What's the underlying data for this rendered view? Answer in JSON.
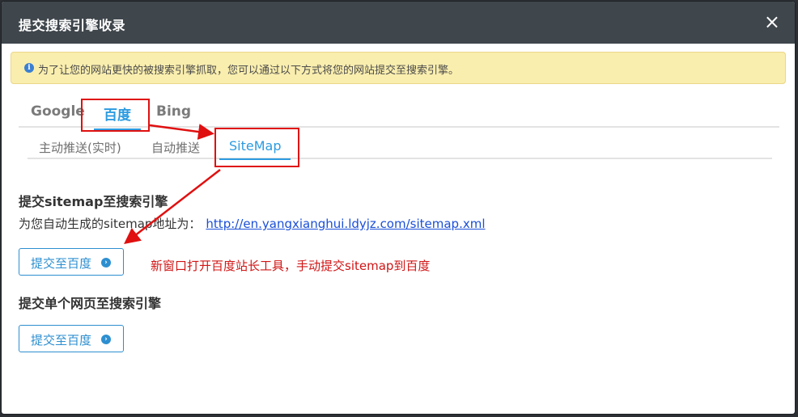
{
  "dialog": {
    "title": "提交搜索引擎收录",
    "close_glyph": "×"
  },
  "notice": {
    "icon": "info-icon",
    "text": "为了让您的网站更快的被搜索引擎抓取，您可以通过以下方式将您的网站提交至搜索引擎。"
  },
  "engine_tabs": [
    {
      "label": "Google",
      "active": false
    },
    {
      "label": "百度",
      "active": true
    },
    {
      "label": "Bing",
      "active": false
    }
  ],
  "sub_tabs": [
    {
      "label": "主动推送(实时)",
      "active": false
    },
    {
      "label": "自动推送",
      "active": false
    },
    {
      "label": "SiteMap",
      "active": true
    }
  ],
  "sitemap_section": {
    "title": "提交sitemap至搜索引擎",
    "url_prefix": "为您自动生成的sitemap地址为：",
    "url": "http://en.yangxianghui.ldyjz.com/sitemap.xml",
    "button_label": "提交至百度",
    "button_icon": "arrow-circle-right-icon"
  },
  "single_page_section": {
    "title": "提交单个网页至搜索引擎",
    "button_label": "提交至百度",
    "button_icon": "arrow-circle-right-icon"
  },
  "annotation": {
    "text": "新窗口打开百度站长工具，手动提交sitemap到百度",
    "color": "#d01515"
  },
  "colors": {
    "header_bg": "#3f464c",
    "accent": "#2d9be0",
    "notice_bg": "#faeeae",
    "highlight": "#e01010"
  }
}
